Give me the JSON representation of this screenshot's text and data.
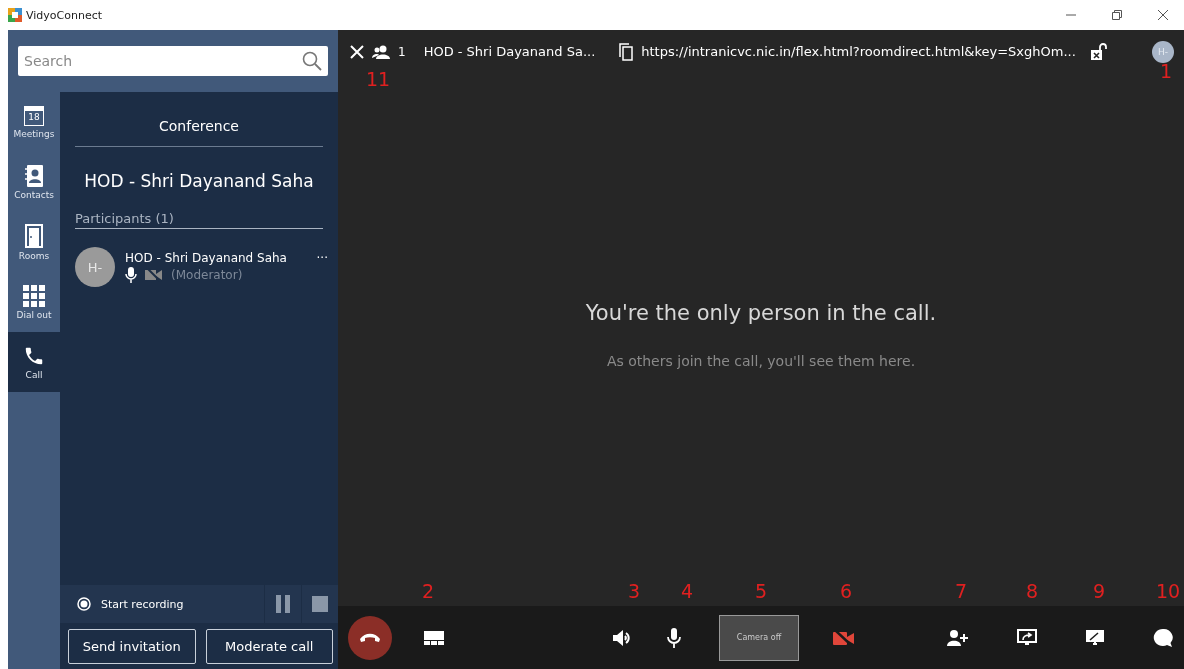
{
  "window": {
    "title": "VidyoConnect"
  },
  "search": {
    "placeholder": "Search"
  },
  "nav": [
    {
      "label": "Meetings",
      "kind": "calendar",
      "day": "18",
      "selected": false
    },
    {
      "label": "Contacts",
      "kind": "contacts",
      "selected": false
    },
    {
      "label": "Rooms",
      "kind": "door",
      "selected": false
    },
    {
      "label": "Dial out",
      "kind": "dialpad",
      "selected": false
    },
    {
      "label": "Call",
      "kind": "phone",
      "selected": true
    }
  ],
  "panel": {
    "heading": "Conference",
    "room": "HOD - Shri Dayanand Saha",
    "participants_heading": "Participants (1)",
    "participants": [
      {
        "initials": "H-",
        "name": "HOD - Shri Dayanand Saha",
        "role": "(Moderator)",
        "more": "···"
      }
    ],
    "recording": {
      "label": "Start recording"
    },
    "buttons": [
      "Send invitation",
      "Moderate call"
    ]
  },
  "call_bar": {
    "count": "1",
    "title": "HOD - Shri Dayanand Sa...",
    "url": "https://intranicvc.nic.in/flex.html?roomdirect.html&key=SxghOm...",
    "avatar": "H-"
  },
  "message": {
    "title": "You're the only person in the call.",
    "subtitle": "As others join the call, you'll see them here."
  },
  "toolbar": {
    "preview": "Camera off"
  },
  "annotations": [
    "11",
    "1",
    "2",
    "3",
    "4",
    "5",
    "6",
    "7",
    "8",
    "9",
    "10"
  ]
}
